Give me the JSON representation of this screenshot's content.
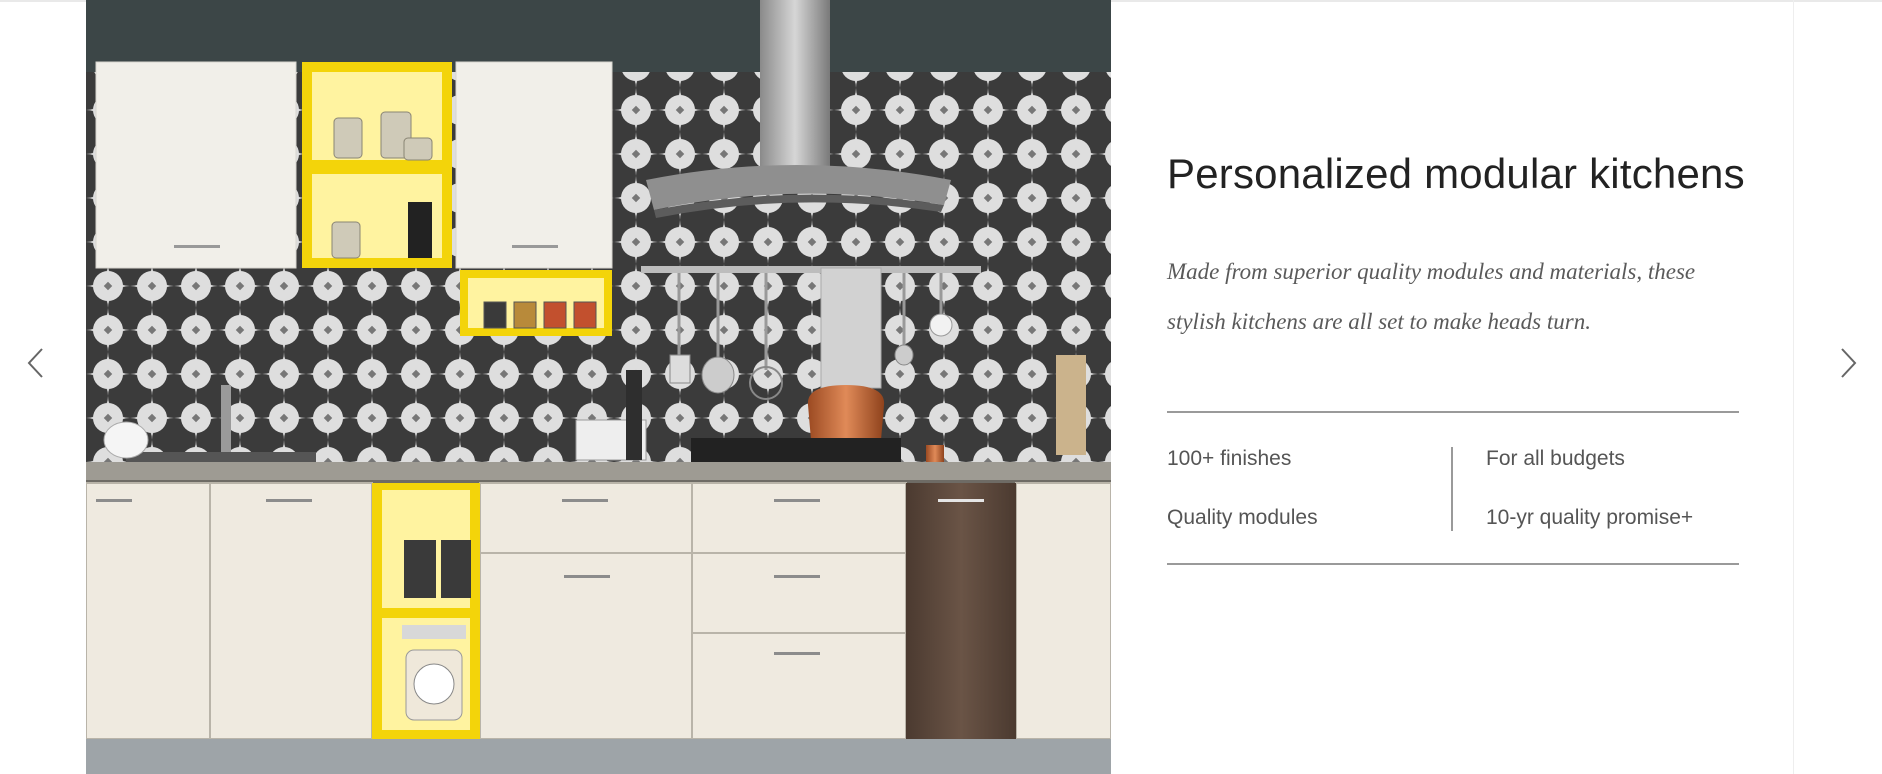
{
  "slide": {
    "image_alt": "Modular kitchen with white cabinets, yellow open shelves, geometric tile backsplash and chimney hood",
    "title": "Personalized modular kitchens",
    "description": "Made from superior quality modules and materials, these stylish kitchens are all set to make heads turn.",
    "features": [
      "100+ finishes",
      "Quality modules",
      "For all budgets",
      "10-yr quality promise+"
    ]
  },
  "carousel": {
    "prev_icon": "chevron-left-icon",
    "next_icon": "chevron-right-icon"
  },
  "colors": {
    "accent_yellow": "#f3d40a",
    "wall": "#3c4647",
    "cabinet": "#efeae0",
    "wood": "#5a463a",
    "rule": "#9a9a9a"
  }
}
